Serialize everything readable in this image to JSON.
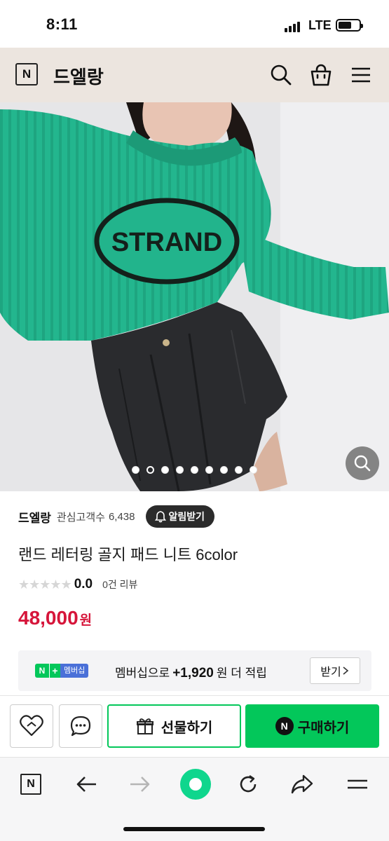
{
  "status_bar": {
    "time": "8:11",
    "network": "LTE",
    "battery_icon": "battery-icon",
    "signal_icon": "signal-icon"
  },
  "header": {
    "logo": "N",
    "store_name": "드엘랑",
    "icons": [
      "search-icon",
      "shopping-bag-icon",
      "menu-icon"
    ]
  },
  "product_image": {
    "alt": "STRAND green ribbed knit sweater with black pleated skirt",
    "knit_text": "STRAND",
    "carousel_dots": 9,
    "active_dot": 1,
    "colors": {
      "knit": "#22b98f",
      "skirt": "#2a2b2e",
      "wall": "#e8e8ea"
    }
  },
  "seller": {
    "name": "드엘랑",
    "followers_label": "관심고객수",
    "followers_count": "6,438",
    "alert_button": "알림받기"
  },
  "product": {
    "title": "랜드 레터링 골지 패드 니트 6color",
    "rating": "0.0",
    "reviews": "0건 리뷰",
    "price": "48,000",
    "currency": "원"
  },
  "membership": {
    "badge_n": "N",
    "badge_plus": "+",
    "badge_text": "멤버십",
    "text_prefix": "멤버십으로",
    "points": "+1,920",
    "text_suffix": "원 더 적립",
    "receive_button": "받기"
  },
  "actions": {
    "gift_label": "선물하기",
    "buy_label": "구매하기",
    "buy_n": "N"
  },
  "browser": {
    "logo": "N"
  },
  "accent_colors": {
    "naver_green": "#03c75a",
    "price_red": "#d6153a"
  }
}
